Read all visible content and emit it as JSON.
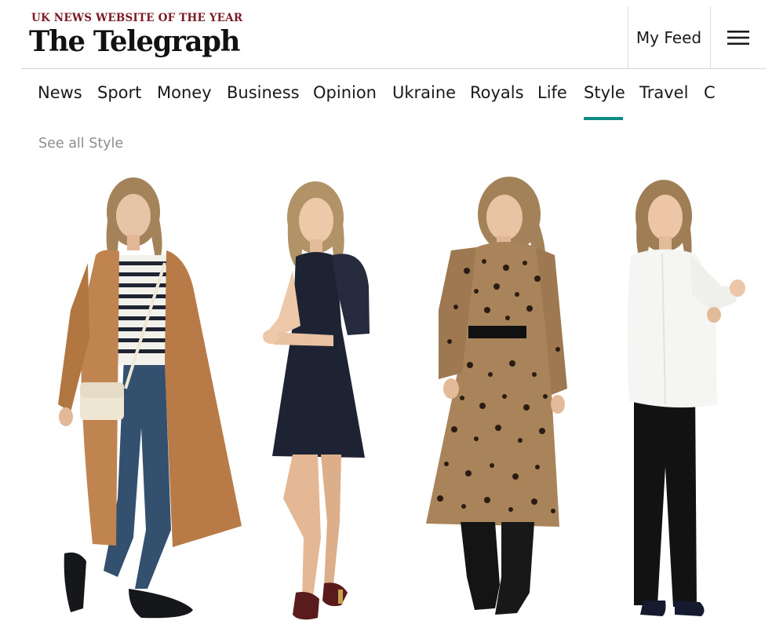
{
  "masthead": {
    "award": "UK NEWS WEBSITE OF THE YEAR",
    "logo": "The Telegraph",
    "my_feed": "My Feed",
    "menu_icon": "hamburger-menu-icon"
  },
  "nav": {
    "items": [
      "News",
      "Sport",
      "Money",
      "Business",
      "Opinion",
      "Ukraine",
      "Royals",
      "Life",
      "Style",
      "Travel",
      "C"
    ],
    "active": "Style",
    "accent": "#0e8a84"
  },
  "section_link": "See all Style",
  "colors": {
    "award": "#7a1b24",
    "muted_link": "#8d8d8d"
  }
}
